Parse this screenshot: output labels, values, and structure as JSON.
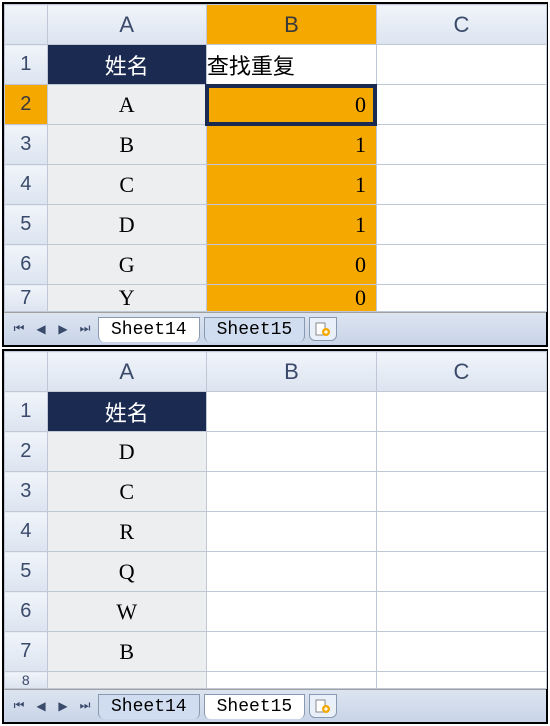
{
  "top": {
    "columns": [
      "A",
      "B",
      "C"
    ],
    "rows": [
      "1",
      "2",
      "3",
      "4",
      "5",
      "6",
      "7"
    ],
    "header": {
      "a": "姓名",
      "b": "查找重复"
    },
    "data": [
      {
        "a": "A",
        "b": "0"
      },
      {
        "a": "B",
        "b": "1"
      },
      {
        "a": "C",
        "b": "1"
      },
      {
        "a": "D",
        "b": "1"
      },
      {
        "a": "G",
        "b": "0"
      },
      {
        "a": "Y",
        "b": "0"
      }
    ],
    "active_col": "B",
    "active_row": "2",
    "tabs": {
      "sheet14": "Sheet14",
      "sheet15": "Sheet15"
    },
    "active_tab": "Sheet14"
  },
  "bottom": {
    "columns": [
      "A",
      "B",
      "C"
    ],
    "rows": [
      "1",
      "2",
      "3",
      "4",
      "5",
      "6",
      "7",
      "8"
    ],
    "header": {
      "a": "姓名"
    },
    "data": [
      {
        "a": "D"
      },
      {
        "a": "C"
      },
      {
        "a": "R"
      },
      {
        "a": "Q"
      },
      {
        "a": "W"
      },
      {
        "a": "B"
      }
    ],
    "tabs": {
      "sheet14": "Sheet14",
      "sheet15": "Sheet15"
    },
    "active_tab": "Sheet15"
  }
}
